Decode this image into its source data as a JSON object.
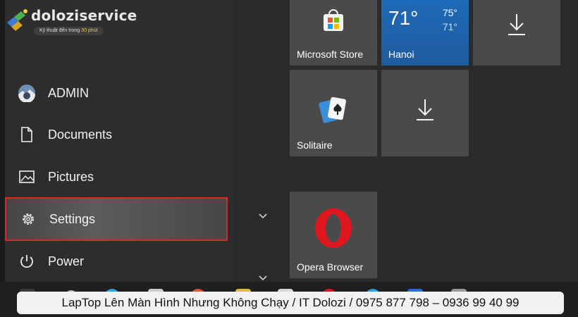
{
  "watermark": {
    "brand": "doloziservice",
    "tagline_prefix": "Kỹ thuật đến trong",
    "tagline_highlight": "30 phút"
  },
  "start_menu": {
    "items": [
      {
        "label": "ADMIN",
        "icon": "user-avatar-icon"
      },
      {
        "label": "Documents",
        "icon": "document-icon"
      },
      {
        "label": "Pictures",
        "icon": "pictures-icon"
      },
      {
        "label": "Settings",
        "icon": "gear-icon",
        "selected": true
      },
      {
        "label": "Power",
        "icon": "power-icon"
      }
    ]
  },
  "tiles": {
    "microsoft_store": {
      "label": "Microsoft Store",
      "icon": "store-bag-icon"
    },
    "weather": {
      "city": "Hanoi",
      "temp": "71°",
      "high": "75°",
      "low": "71°"
    },
    "download_1": {
      "icon": "download-arrow-icon"
    },
    "solitaire": {
      "label": "Solitaire",
      "icon": "cards-icon"
    },
    "download_2": {
      "icon": "download-arrow-icon"
    },
    "opera": {
      "label": "Opera Browser",
      "icon": "opera-icon"
    }
  },
  "caption": "LapTop Lên Màn Hình Nhưng Không Chạy / IT Dolozi / 0975 877 798 – 0936 99 40 99",
  "colors": {
    "highlight_border": "#d52a2a",
    "weather_tile": "#1e6ab8",
    "opera_red": "#e0161e"
  }
}
